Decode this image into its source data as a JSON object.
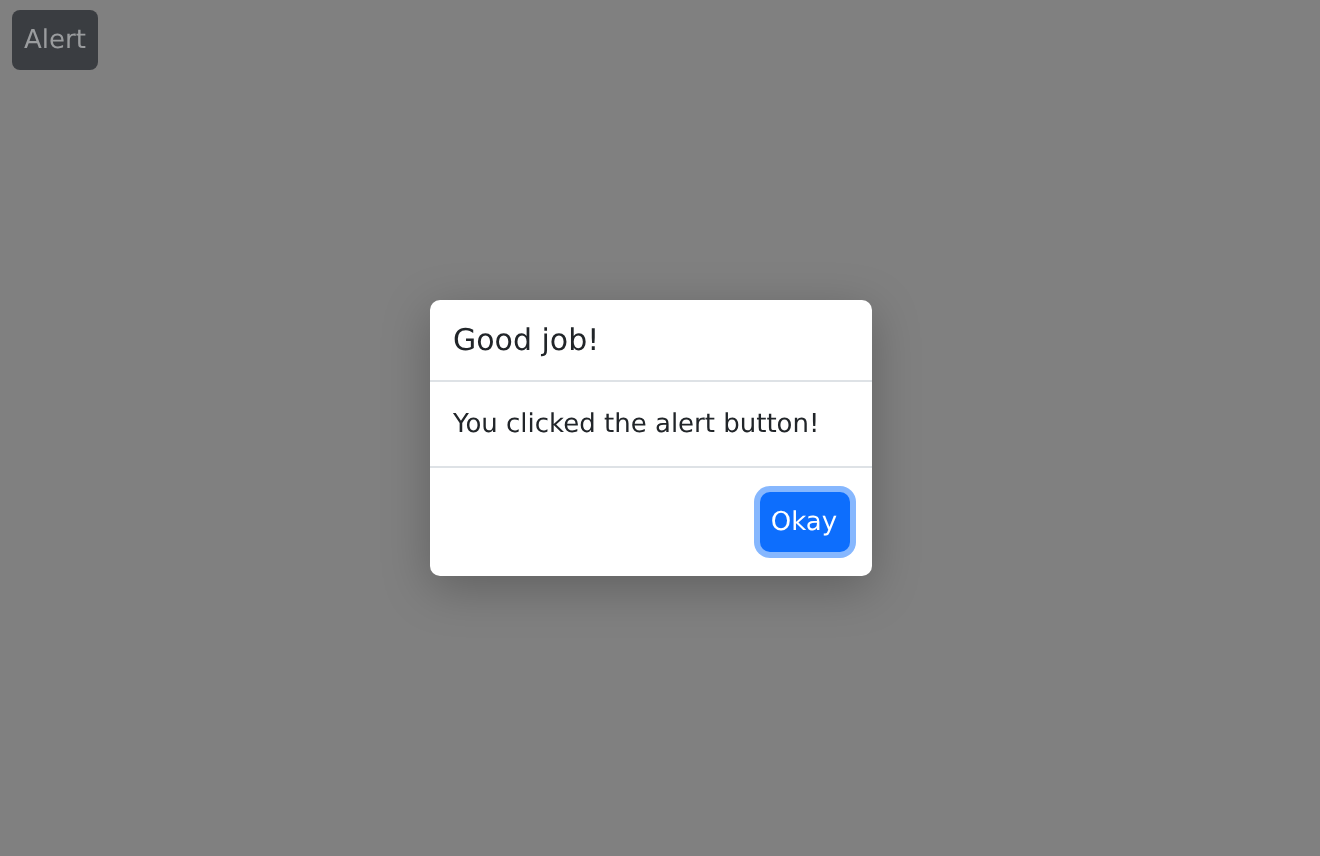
{
  "trigger_button": {
    "label": "Alert"
  },
  "dialog": {
    "title": "Good job!",
    "message": "You clicked the alert button!",
    "buttons": [
      {
        "label": "Okay",
        "focused": true
      }
    ]
  }
}
